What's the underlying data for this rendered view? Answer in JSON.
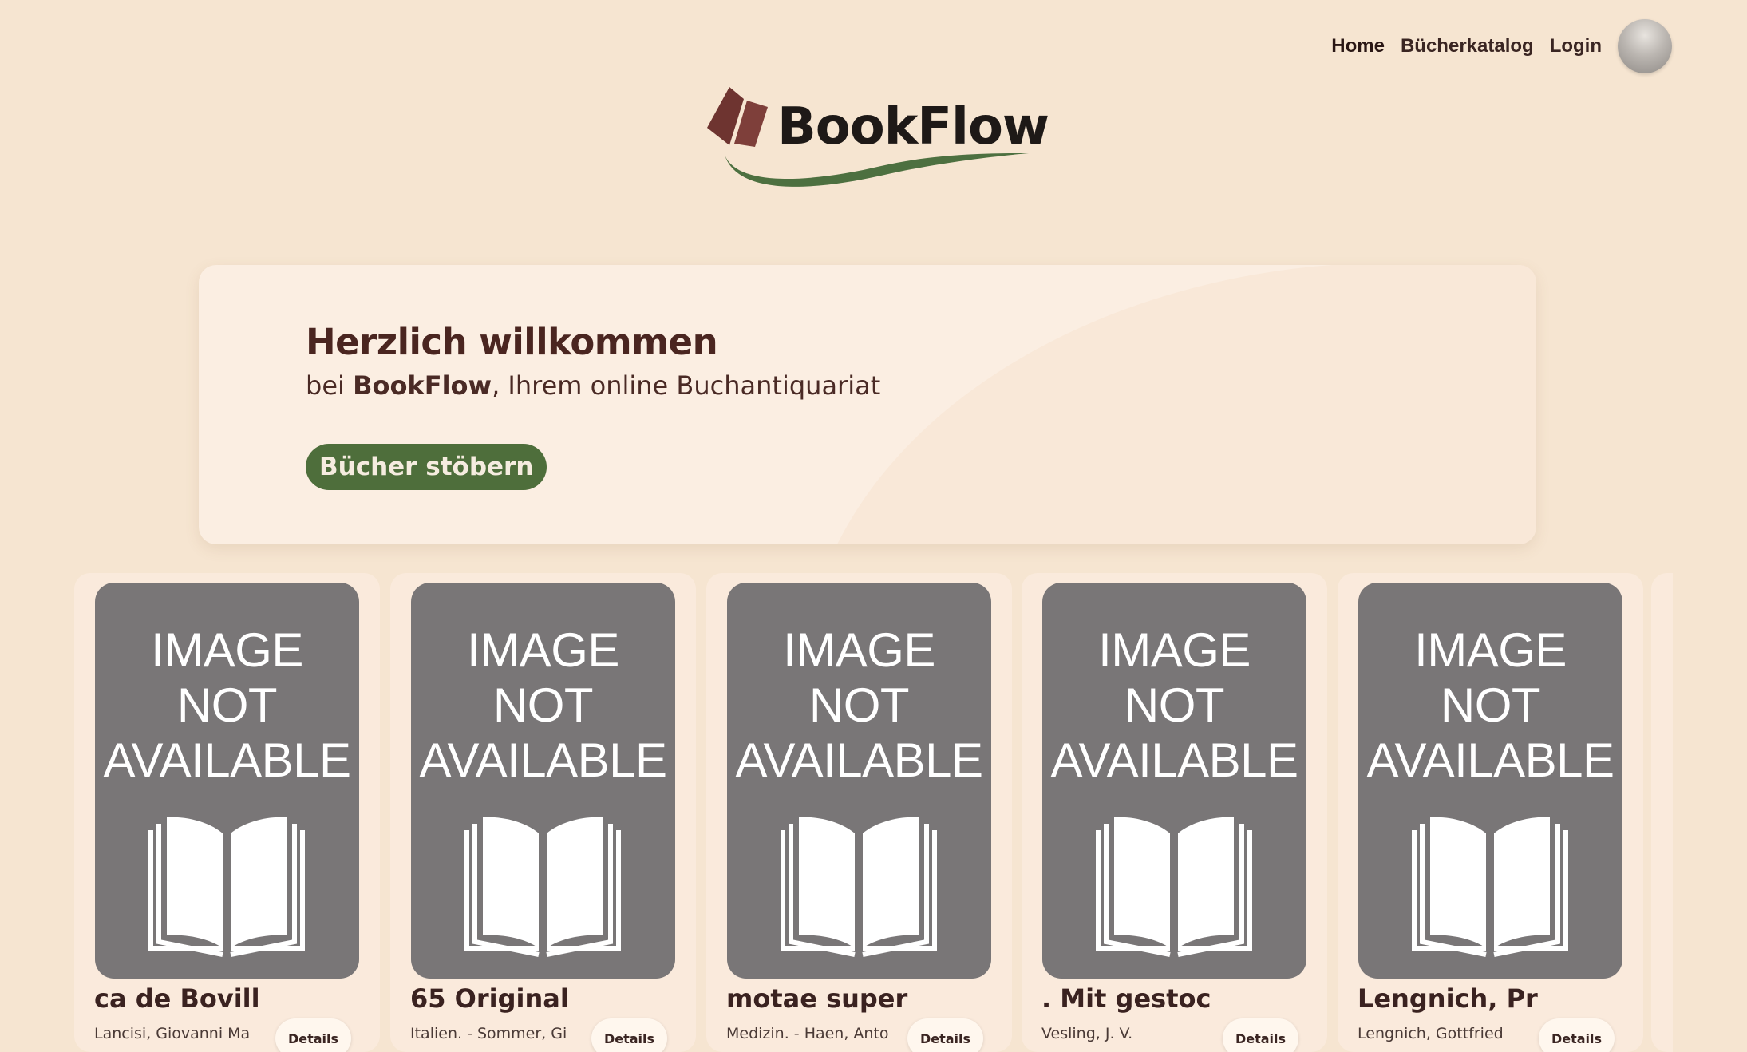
{
  "nav": {
    "items": [
      {
        "label": "Home"
      },
      {
        "label": "Bücherkatalog"
      },
      {
        "label": "Login"
      }
    ]
  },
  "logo": {
    "text": "BookFlow"
  },
  "hero": {
    "title": "Herzlich willkommen",
    "subtitle_prefix": "bei ",
    "subtitle_brand": "BookFlow",
    "subtitle_suffix": ", Ihrem online Buchantiquariat",
    "button_label": "Bücher stöbern"
  },
  "placeholder": {
    "line1": "IMAGE",
    "line2": "NOT",
    "line3": "AVAILABLE"
  },
  "books": [
    {
      "title": "ca de Bovill",
      "author": "Lancisi, Giovanni Ma",
      "button": "Details"
    },
    {
      "title": "65 Original",
      "author": "Italien. - Sommer, Gi",
      "button": "Details"
    },
    {
      "title": "motae super",
      "author": "Medizin. - Haen, Anto",
      "button": "Details"
    },
    {
      "title": ". Mit gestoc",
      "author": "Vesling, J. V.",
      "button": "Details"
    },
    {
      "title": "Lengnich, Pr",
      "author": "Lengnich, Gottfried",
      "button": "Details"
    }
  ],
  "colors": {
    "background": "#f6e5d1",
    "accent_green": "#4e6e3b",
    "logo_book": "#7a3b36",
    "text_dark": "#3d2420"
  }
}
